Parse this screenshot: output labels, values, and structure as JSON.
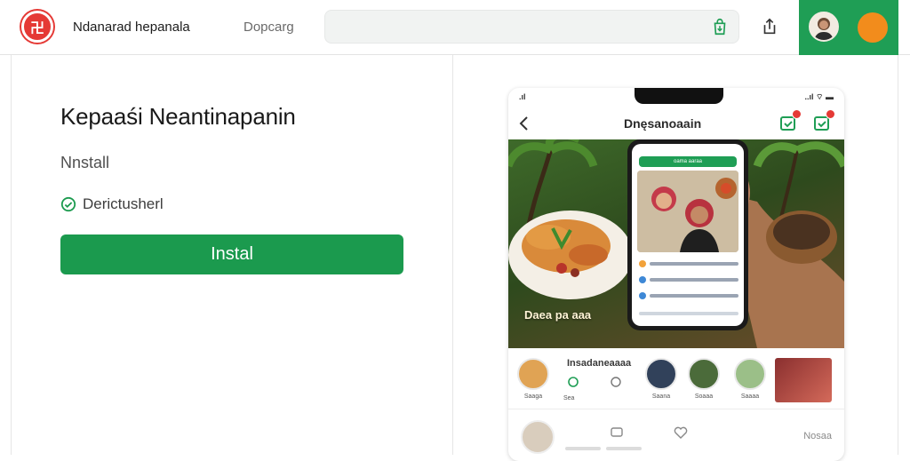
{
  "header": {
    "logo_glyph": "卍",
    "app_title": "Ndanarad hepanala",
    "developer": "Dopcarg",
    "search_placeholder": "",
    "accent": "#1f9e55",
    "orange": "#f28c1c"
  },
  "listing": {
    "title": "Kepaaśi Neantinapanin",
    "install_label": "Nnstall",
    "verified_text": "Derictusherl",
    "install_button": "Instal",
    "button_color": "#1b9a4e"
  },
  "preview": {
    "status_time": ".ıl",
    "status_icons": "..ıl ⌔ ▬",
    "screen_title": "Dnęsanoaain",
    "hero_caption": "Daea pa aaa",
    "inner_bar_text": "oama aaraa",
    "stories_title": "Insadaneaaaa",
    "stories": [
      {
        "label": "Saaga"
      },
      {
        "label": "Sea"
      },
      {
        "label": ""
      },
      {
        "label": "Saana"
      },
      {
        "label": "Soaaa"
      },
      {
        "label": "Saaaa"
      }
    ],
    "feed_label": "Nosaa"
  },
  "icons": {
    "logo": "brand-logo-icon",
    "bag": "shopping-bag-icon",
    "share": "share-icon",
    "check": "check-circle-icon",
    "back": "chevron-left-icon"
  }
}
